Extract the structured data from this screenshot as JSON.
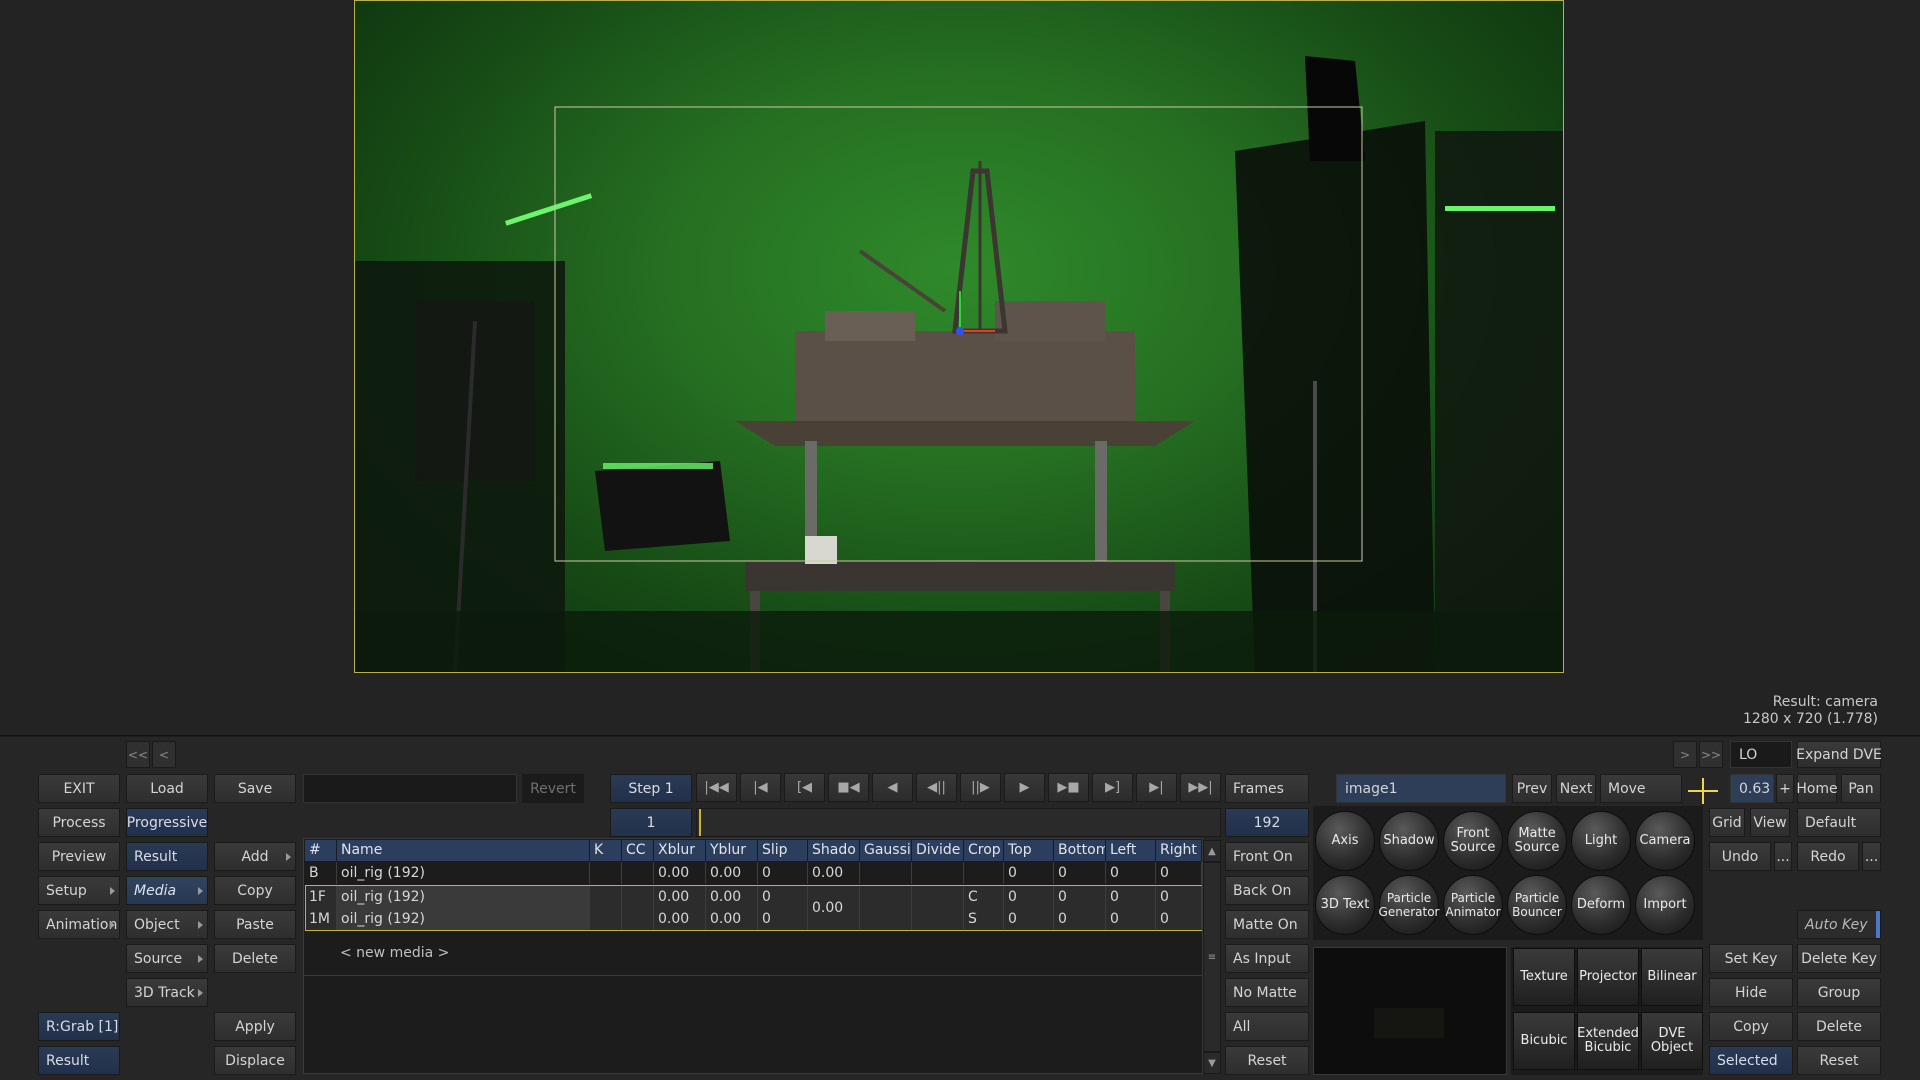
{
  "viewer": {
    "result_label": "Result: camera",
    "result_dims": "1280 x 720 (1.778)"
  },
  "nav": {
    "first": "<<",
    "prev": "<",
    "next": ">",
    "last": ">>"
  },
  "left_col": {
    "exit": "EXIT",
    "process": "Process",
    "preview": "Preview",
    "setup": "Setup",
    "animation": "Animation",
    "rgrab": "R:Grab [1]",
    "result": "Result"
  },
  "col2": {
    "load": "Load",
    "progressive": "Progressive",
    "result": "Result",
    "media": "Media",
    "object": "Object",
    "source": "Source",
    "track3d": "3D Track"
  },
  "col3": {
    "save": "Save",
    "add": "Add",
    "copy": "Copy",
    "paste": "Paste",
    "delete": "Delete",
    "apply": "Apply",
    "displace": "Displace"
  },
  "top_bar": {
    "name_field": "",
    "revert": "Revert",
    "step": "Step 1",
    "frames": "Frames",
    "current_frame": "1",
    "total_frames": "192"
  },
  "table": {
    "headers": [
      "#",
      "Name",
      "K",
      "CC",
      "Xblur",
      "Yblur",
      "Slip",
      "Shado",
      "Gaussi",
      "Divide",
      "Crop",
      "Top",
      "Bottom",
      "Left",
      "Right"
    ],
    "rows": [
      {
        "id": "B",
        "name": "oil_rig (192)",
        "k": "",
        "cc": "",
        "xblur": "0.00",
        "yblur": "0.00",
        "slip": "0",
        "shadow": "0.00",
        "gauss": "",
        "divide": "",
        "crop": "",
        "top": "0",
        "bottom": "0",
        "left": "0",
        "right": "0"
      },
      {
        "id": "1F",
        "name": "oil_rig (192)",
        "k": "",
        "cc": "",
        "xblur": "0.00",
        "yblur": "0.00",
        "slip": "0",
        "shadow": "0.00",
        "gauss": "",
        "divide": "",
        "crop": "C",
        "top": "0",
        "bottom": "0",
        "left": "0",
        "right": "0"
      },
      {
        "id": "1M",
        "name": "oil_rig (192)",
        "k": "",
        "cc": "",
        "xblur": "0.00",
        "yblur": "0.00",
        "slip": "0",
        "shadow": "",
        "gauss": "",
        "divide": "",
        "crop": "S",
        "top": "0",
        "bottom": "0",
        "left": "0",
        "right": "0"
      }
    ],
    "new_media": "< new media >"
  },
  "matte_col": {
    "front_on": "Front On",
    "back_on": "Back On",
    "matte_on": "Matte On",
    "as_input": "As Input",
    "no_matte": "No Matte",
    "all": "All",
    "reset": "Reset"
  },
  "right_top": {
    "node_name": "image1",
    "prev": "Prev",
    "next": "Next",
    "move": "Move",
    "lo": "LO",
    "expand": "Expand DVE",
    "zoom": "0.63",
    "plus": "+",
    "home": "Home",
    "pan": "Pan",
    "grid": "Grid",
    "view": "View",
    "default": "Default",
    "undo": "Undo",
    "more": "...",
    "redo": "Redo",
    "more2": "..."
  },
  "nodes": {
    "row1": [
      "Axis",
      "Shadow",
      "Front\nSource",
      "Matte\nSource",
      "Light",
      "Camera"
    ],
    "row2": [
      "3D Text",
      "Particle\nGenerator",
      "Particle\nAnimator",
      "Particle\nBouncer",
      "Deform",
      "Import"
    ]
  },
  "boxes": {
    "row1": [
      "Texture",
      "Projector",
      "Bilinear"
    ],
    "row2": [
      "Bicubic",
      "Extended\nBicubic",
      "DVE\nObject"
    ]
  },
  "keys": {
    "auto_key": "Auto Key",
    "set_key": "Set Key",
    "delete_key": "Delete Key",
    "hide": "Hide",
    "group": "Group",
    "copy": "Copy",
    "delete": "Delete",
    "selected": "Selected",
    "reset": "Reset"
  },
  "colors": {
    "accent_blue": "#2c3e5e",
    "frame_border": "#b8b04a",
    "highlight": "#c9b23a"
  }
}
